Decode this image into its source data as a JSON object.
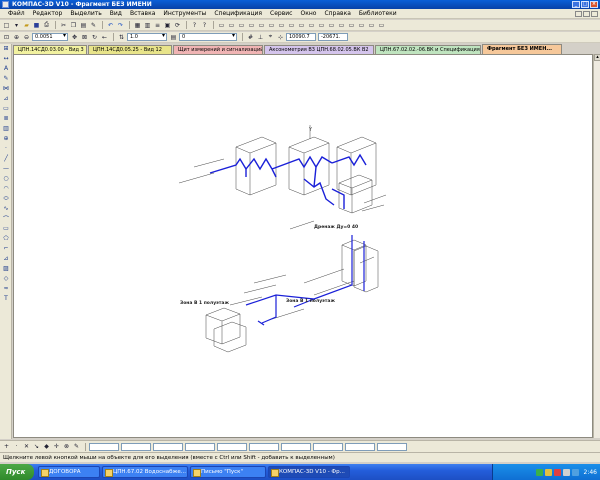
{
  "window": {
    "title": "КОМПАС-3D V10 - Фрагмент БЕЗ ИМЕНИ"
  },
  "menu": [
    "Файл",
    "Редактор",
    "Выделить",
    "Вид",
    "Вставка",
    "Инструменты",
    "Спецификация",
    "Сервис",
    "Окно",
    "Справка",
    "Библиотеки"
  ],
  "toolbar": {
    "scale": "0.0051",
    "layer": "1.0",
    "style": "0",
    "coord_x": "10090.7",
    "coord_y": "-20671."
  },
  "tabs": [
    {
      "label": "ЦПН.14СД0.03.00 - Вид 3",
      "color": "#f2f2a0",
      "active": false
    },
    {
      "label": "ЦПН.14СД0.05.25 - Вид 12",
      "color": "#e8e48a",
      "active": false
    },
    {
      "label": "Щит измерений и сигнализаций",
      "color": "#f0b4b4",
      "active": false
    },
    {
      "label": "Аксонометрия В3 ЦПН.68.02.05.ВК В2",
      "color": "#d4c4ec",
      "active": false
    },
    {
      "label": "ЦПН.67.02.02.-06.ВК и Спецификация",
      "color": "#bfe4bf",
      "active": false
    },
    {
      "label": "Фрагмент БЕЗ ИМЕН...",
      "color": "#f6c89a",
      "active": true
    }
  ],
  "status": "Щелкните левой кнопкой мыши на объекте для его выделения (вместе с Ctrl или Shift - добавить к выделенным)",
  "taskbar": {
    "start": "Пуск",
    "items": [
      {
        "label": "ДОГОВОРА",
        "active": false
      },
      {
        "label": "ЦПН.67.02 Водоснабже...",
        "active": false
      },
      {
        "label": "Письмо \"Пуск\"",
        "active": false
      },
      {
        "label": "КОМПАС-3D V10 - Фр...",
        "active": true
      }
    ],
    "clock": "2:46"
  },
  "drawing_labels": {
    "label_a": "Дренаж Ду=0 40",
    "label_b": "Зона В 1 полуэтаж",
    "label_c": "Зона В 1 полуэтаж",
    "axis": "Y"
  },
  "colors": {
    "pipe": "#1a20d8",
    "accent_title": "#0a5fd8"
  }
}
